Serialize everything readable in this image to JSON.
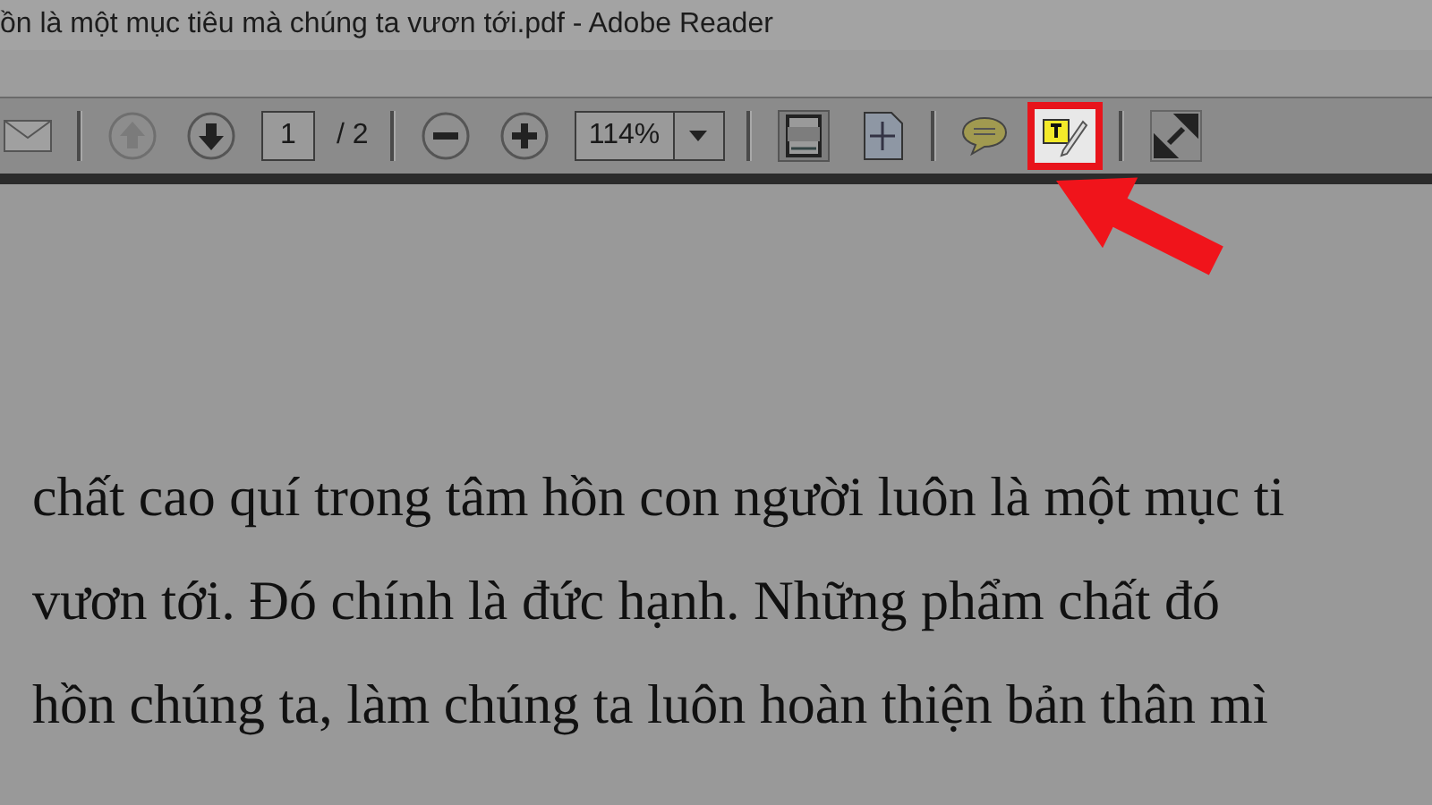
{
  "window": {
    "title": "ồn là một mục tiêu mà chúng ta vươn tới.pdf - Adobe Reader"
  },
  "toolbar": [
    {
      "kind": "email",
      "disabled": false,
      "highlighted": false
    },
    {
      "kind": "separator"
    },
    {
      "kind": "prev",
      "disabled": true,
      "highlighted": false
    },
    {
      "kind": "next",
      "disabled": false,
      "highlighted": false
    },
    {
      "kind": "page",
      "value": "1"
    },
    {
      "kind": "total",
      "text": "/ 2"
    },
    {
      "kind": "separator"
    },
    {
      "kind": "zoom-out",
      "disabled": false,
      "highlighted": false
    },
    {
      "kind": "zoom-in",
      "disabled": false,
      "highlighted": false
    },
    {
      "kind": "zoom",
      "value": "114%"
    },
    {
      "kind": "separator"
    },
    {
      "kind": "fit-width",
      "disabled": false,
      "highlighted": false
    },
    {
      "kind": "fit-page",
      "disabled": false,
      "highlighted": false
    },
    {
      "kind": "separator"
    },
    {
      "kind": "comment",
      "disabled": false,
      "highlighted": false
    },
    {
      "kind": "typewriter",
      "disabled": false,
      "highlighted": true
    },
    {
      "kind": "separator"
    },
    {
      "kind": "fullscreen",
      "disabled": false,
      "highlighted": false
    }
  ],
  "document": {
    "lines": [
      "chất cao quí trong tâm hồn con người luôn là một mục ti",
      "vươn tới. Đó chính là đức hạnh. Những phẩm chất đó",
      "hồn chúng ta, làm chúng ta luôn hoàn thiện bản thân mì"
    ]
  }
}
